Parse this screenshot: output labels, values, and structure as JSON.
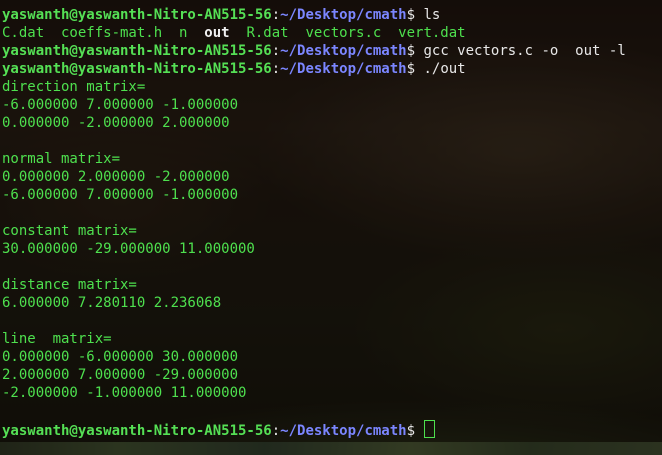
{
  "prompt": {
    "user_host": "yaswanth@yaswanth-Nitro-AN515-56",
    "sep": ":",
    "path": "~/Desktop/cmath",
    "dollar": "$"
  },
  "commands": {
    "ls": " ls",
    "gcc": " gcc vectors.c -o  out -l",
    "run": " ./out"
  },
  "ls_output": {
    "before_out": "C.dat  coeffs-mat.h  n  ",
    "out_file": "out",
    "after_out": "  R.dat  vectors.c  vert.dat"
  },
  "output_lines": [
    "direction matrix=",
    "-6.000000 7.000000 -1.000000",
    "0.000000 -2.000000 2.000000",
    "normal matrix=",
    "0.000000 2.000000 -2.000000",
    "-6.000000 7.000000 -1.000000",
    "constant matrix=",
    "30.000000 -29.000000 11.000000",
    "distance matrix=",
    "6.000000 7.280110 2.236068",
    "line  matrix=",
    "0.000000 -6.000000 30.000000",
    "2.000000 7.000000 -29.000000",
    "-2.000000 -1.000000 11.000000"
  ]
}
